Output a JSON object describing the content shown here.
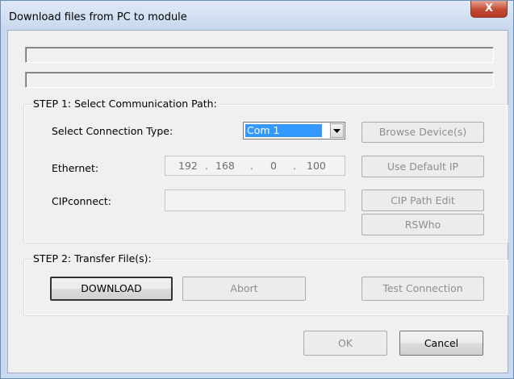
{
  "window": {
    "title": "Download files from PC to module",
    "close_label": "X"
  },
  "step1": {
    "legend": "STEP 1: Select Communication Path:",
    "connection_type_label": "Select Connection Type:",
    "connection_type_value": "Com 1",
    "ethernet_label": "Ethernet:",
    "ip": [
      "192",
      "168",
      "0",
      "100"
    ],
    "cipconnect_label": "CIPconnect:",
    "cipconnect_value": "",
    "browse_label": "Browse Device(s)",
    "default_ip_label": "Use Default IP",
    "cip_path_label": "CIP Path Edit",
    "rswho_label": "RSWho"
  },
  "step2": {
    "legend": "STEP 2: Transfer File(s):",
    "download_label": "DOWNLOAD",
    "abort_label": "Abort",
    "test_label": "Test Connection"
  },
  "footer": {
    "ok_label": "OK",
    "cancel_label": "Cancel"
  }
}
